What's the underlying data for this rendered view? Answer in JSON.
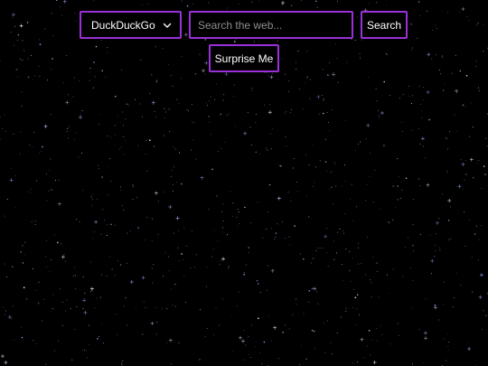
{
  "search": {
    "engine_selected": "DuckDuckGo",
    "placeholder": "Search the web...",
    "query_value": "",
    "search_label": "Search",
    "surprise_label": "Surprise Me"
  },
  "theme": {
    "background": "#000000",
    "accent": "#9b30d9",
    "text": "#ffffff",
    "placeholder": "#8d8d8d",
    "stars": [
      "#ffffff",
      "#b9a6ff",
      "#8fa8ff",
      "#e6c8ff"
    ]
  },
  "icons": {
    "engine_dropdown": "chevron-down-icon"
  }
}
